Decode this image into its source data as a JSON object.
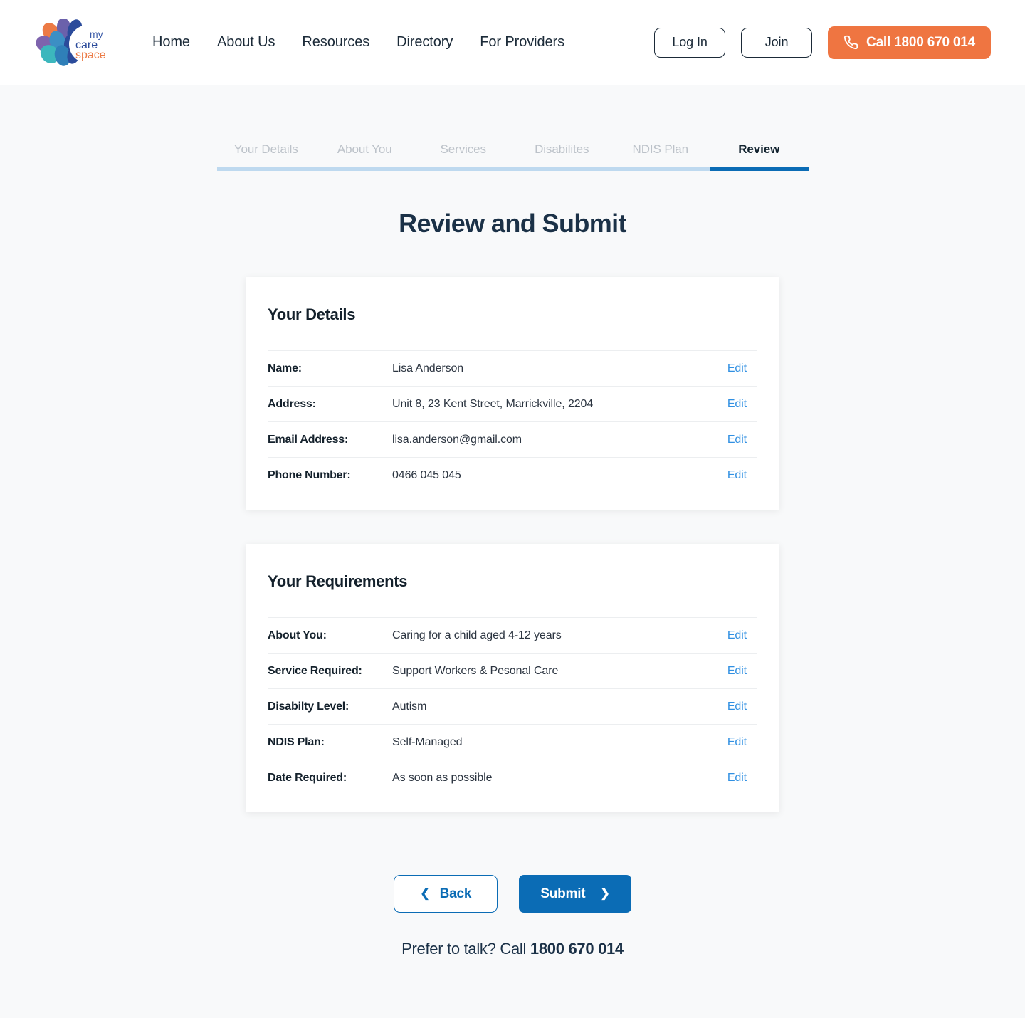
{
  "brand": {
    "logo_name": "my care space",
    "logo_line1": "my",
    "logo_line2": "care",
    "logo_line3": "space",
    "colors": {
      "orange": "#ef7541",
      "primary_blue": "#0b6cb5",
      "link_blue": "#3190e2",
      "track_blue": "#bed9ef",
      "dark": "#1b2a38"
    }
  },
  "header": {
    "nav": [
      {
        "label": "Home"
      },
      {
        "label": "About Us"
      },
      {
        "label": "Resources"
      },
      {
        "label": "Directory"
      },
      {
        "label": "For Providers"
      }
    ],
    "login_label": "Log In",
    "join_label": "Join",
    "call_label": "Call 1800 670 014",
    "call_icon": "phone-icon"
  },
  "steps": {
    "items": [
      {
        "label": "Your Details",
        "active": false
      },
      {
        "label": "About You",
        "active": false
      },
      {
        "label": "Services",
        "active": false
      },
      {
        "label": "Disabilites",
        "active": false
      },
      {
        "label": "NDIS Plan",
        "active": false
      },
      {
        "label": "Review",
        "active": true
      }
    ],
    "current_index": 6,
    "total": 6
  },
  "main": {
    "title": "Review and Submit",
    "cards": [
      {
        "title": "Your Details",
        "rows": [
          {
            "label": "Name:",
            "value": "Lisa Anderson",
            "edit": "Edit"
          },
          {
            "label": "Address:",
            "value": "Unit 8, 23 Kent Street, Marrickville, 2204",
            "edit": "Edit"
          },
          {
            "label": "Email Address:",
            "value": "lisa.anderson@gmail.com",
            "edit": "Edit"
          },
          {
            "label": "Phone Number:",
            "value": "0466 045 045",
            "edit": "Edit"
          }
        ]
      },
      {
        "title": "Your Requirements",
        "rows": [
          {
            "label": "About You:",
            "value": "Caring for a child aged 4-12 years",
            "edit": "Edit"
          },
          {
            "label": "Service Required:",
            "value": "Support Workers & Pesonal Care",
            "edit": "Edit"
          },
          {
            "label": "Disabilty Level:",
            "value": "Autism",
            "edit": "Edit"
          },
          {
            "label": "NDIS Plan:",
            "value": "Self-Managed",
            "edit": "Edit"
          },
          {
            "label": "Date Required:",
            "value": "As soon as possible",
            "edit": "Edit"
          }
        ]
      }
    ]
  },
  "actions": {
    "back_label": "Back",
    "back_icon": "chevron-left-icon",
    "submit_label": "Submit",
    "submit_icon": "chevron-right-icon"
  },
  "footer": {
    "prefer_text": "Prefer to talk? Call",
    "prefer_phone": "1800 670 014"
  }
}
